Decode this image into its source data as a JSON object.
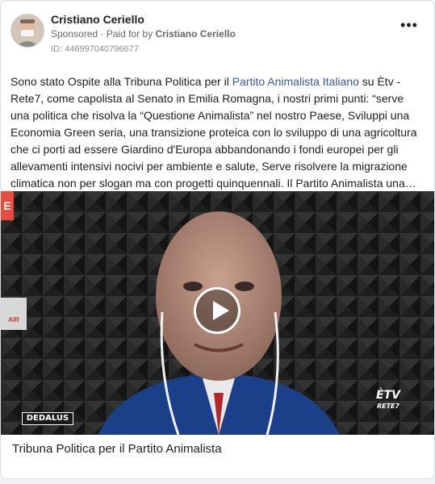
{
  "post": {
    "author": "Cristiano Ceriello",
    "sponsored_label": "Sponsored",
    "paid_prefix": "Paid for by",
    "paid_by": "Cristiano Ceriello",
    "ad_id": "ID: 446997040796677",
    "more_label": "•••",
    "text_part1": "Sono stato Ospite alla Tribuna Politica per il ",
    "text_link": "Partito Animalista Italiano",
    "text_part2": " su Ètv - Rete7, come capolista al Senato in Emilia Romagna, i nostri primi punti: “serve una politica che risolva la “Questione Animalista” nel nostro Paese, Sviluppi una Economia Green seria, una transizione proteica con lo sviluppo di una agricoltura che ci porti ad essere Giardino d'Europa abbandonando i fondi europei per gli allevamenti intensivi nocivi per ambiente e salute, Serve risolvere la migrazione climatica non per slogan ma con progetti quinquennali. Il Partito Animalista una…"
  },
  "video": {
    "left_logo": "DEDALUS",
    "right_logo_main": "ÈTV",
    "right_logo_sub": "RETE7",
    "edge_tag_top": "E",
    "edge_tag_mid": "AIR"
  },
  "caption": "Tribuna Politica per il Partito Animalista"
}
